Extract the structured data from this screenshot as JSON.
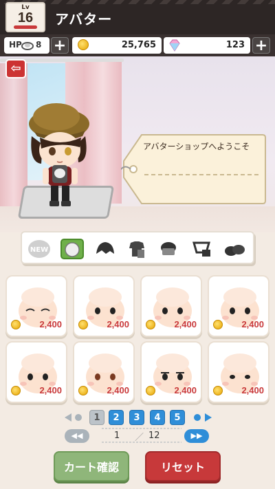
{
  "header": {
    "level_label": "Lv",
    "level": "16",
    "title": "アバター"
  },
  "status": {
    "hp_label": "HP",
    "hp_value": "8",
    "coins": "25,765",
    "gems": "123",
    "plus_label": "+"
  },
  "stage": {
    "welcome_text": "アバターショップへようこそ",
    "back_label": "⇦"
  },
  "categories": [
    {
      "name": "new",
      "label": "NEW"
    },
    {
      "name": "face"
    },
    {
      "name": "hair"
    },
    {
      "name": "outfit"
    },
    {
      "name": "hat"
    },
    {
      "name": "accessory"
    },
    {
      "name": "shoes"
    }
  ],
  "items": [
    {
      "price": "2,400"
    },
    {
      "price": "2,400"
    },
    {
      "price": "2,400"
    },
    {
      "price": "2,400"
    },
    {
      "price": "2,400"
    },
    {
      "price": "2,400"
    },
    {
      "price": "2,400"
    },
    {
      "price": "2,400"
    }
  ],
  "pagination": {
    "pages": [
      "1",
      "2",
      "3",
      "4",
      "5"
    ],
    "current": "1",
    "separator": "／",
    "total": "12",
    "prev_jump": "◀◀",
    "next_jump": "▶▶"
  },
  "buttons": {
    "cart": "カート確認",
    "reset": "リセット"
  },
  "colors": {
    "header_bg": "#2d2625",
    "selected_tab": "#6fb04a",
    "price_red": "#c9393a",
    "page_blue": "#2f8ed8",
    "cart_green": "#8fb67a",
    "reset_red": "#c7393a"
  }
}
